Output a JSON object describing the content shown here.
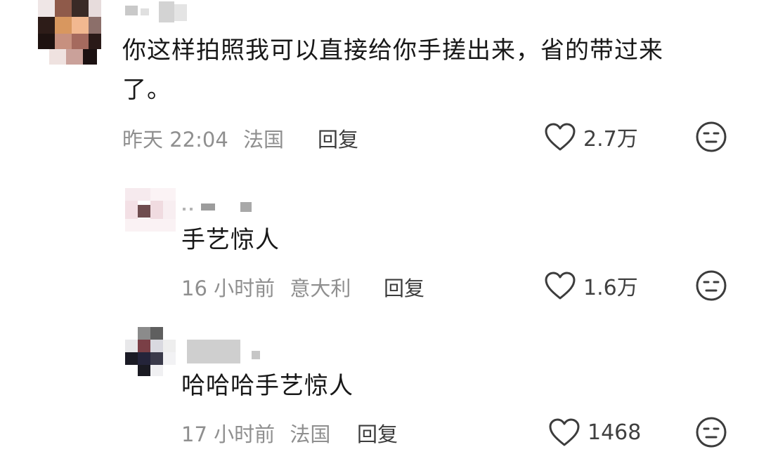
{
  "comments": [
    {
      "text_lines": [
        "你这样拍照我可以直接给你手搓出来，省的带过来",
        "了。"
      ],
      "time": "昨天 22:04",
      "location": "法国",
      "reply_label": "回复",
      "likes": "2.7万",
      "like_icon": "heart-outline-icon",
      "dislike_icon": "meh-face-icon"
    },
    {
      "text_lines": [
        "手艺惊人"
      ],
      "time": "16 小时前",
      "location": "意大利",
      "reply_label": "回复",
      "likes": "1.6万",
      "like_icon": "heart-outline-icon",
      "dislike_icon": "meh-face-icon"
    },
    {
      "text_lines": [
        "哈哈哈手艺惊人"
      ],
      "time": "17 小时前",
      "location": "法国",
      "reply_label": "回复",
      "likes": "1468",
      "like_icon": "heart-outline-icon",
      "dislike_icon": "meh-face-icon"
    }
  ],
  "colors": {
    "text": "#181818",
    "meta": "#8f8f8f",
    "icon": "#3c3c3c"
  }
}
